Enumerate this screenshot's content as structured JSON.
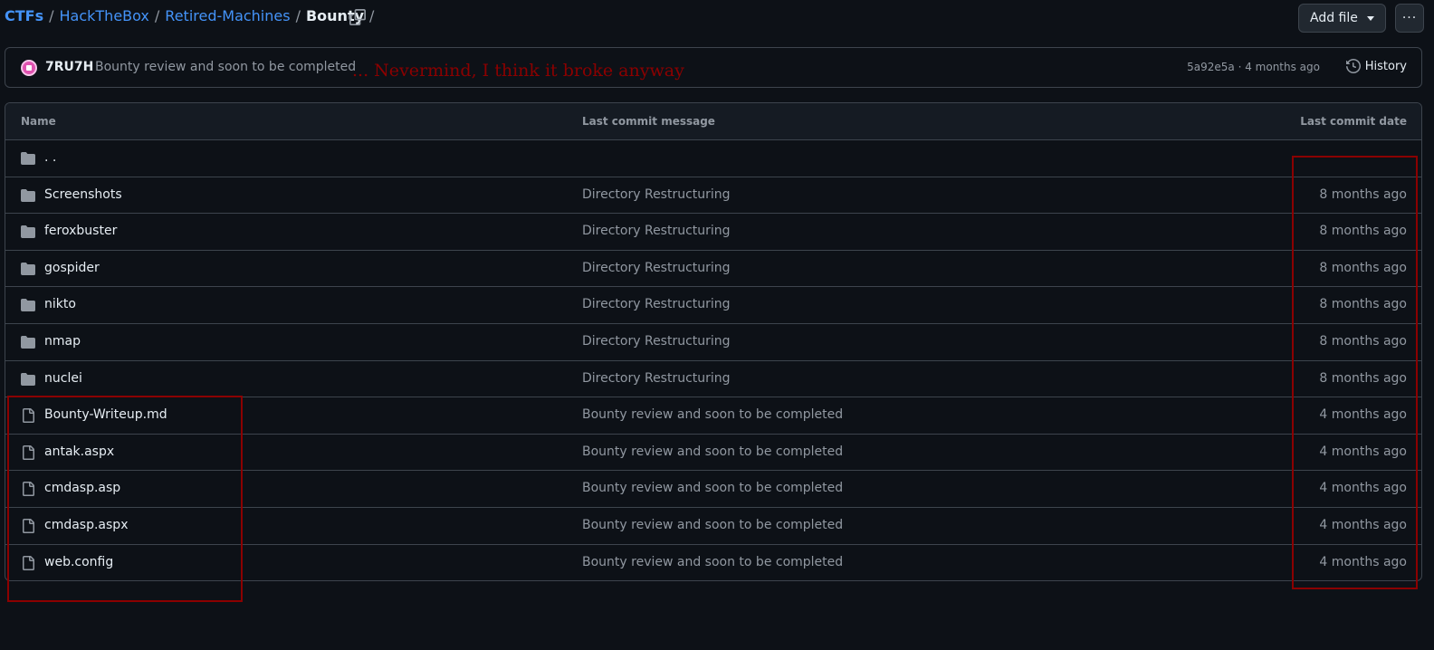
{
  "breadcrumb": {
    "items": [
      "CTFs",
      "HackTheBox",
      "Retired-Machines"
    ],
    "current": "Bounty",
    "separator": "/"
  },
  "toolbar": {
    "add_file_label": "Add file",
    "more_label": "···"
  },
  "latest_commit": {
    "author": "7RU7H",
    "message": "Bounty review and soon to be completed",
    "hash_and_time": "5a92e5a · 4 months ago",
    "history_label": "History"
  },
  "annotation": {
    "text": "... Nevermind, I think it broke anyway",
    "color": "#8b0000"
  },
  "table": {
    "headers": {
      "name": "Name",
      "message": "Last commit message",
      "date": "Last commit date"
    },
    "rows": [
      {
        "type": "folder",
        "name": ". .",
        "message": "",
        "date": ""
      },
      {
        "type": "folder",
        "name": "Screenshots",
        "message": "Directory Restructuring",
        "date": "8 months ago"
      },
      {
        "type": "folder",
        "name": "feroxbuster",
        "message": "Directory Restructuring",
        "date": "8 months ago"
      },
      {
        "type": "folder",
        "name": "gospider",
        "message": "Directory Restructuring",
        "date": "8 months ago"
      },
      {
        "type": "folder",
        "name": "nikto",
        "message": "Directory Restructuring",
        "date": "8 months ago"
      },
      {
        "type": "folder",
        "name": "nmap",
        "message": "Directory Restructuring",
        "date": "8 months ago"
      },
      {
        "type": "folder",
        "name": "nuclei",
        "message": "Directory Restructuring",
        "date": "8 months ago"
      },
      {
        "type": "file",
        "name": "Bounty-Writeup.md",
        "message": "Bounty review and soon to be completed",
        "date": "4 months ago"
      },
      {
        "type": "file",
        "name": "antak.aspx",
        "message": "Bounty review and soon to be completed",
        "date": "4 months ago"
      },
      {
        "type": "file",
        "name": "cmdasp.asp",
        "message": "Bounty review and soon to be completed",
        "date": "4 months ago"
      },
      {
        "type": "file",
        "name": "cmdasp.aspx",
        "message": "Bounty review and soon to be completed",
        "date": "4 months ago"
      },
      {
        "type": "file",
        "name": "web.config",
        "message": "Bounty review and soon to be completed",
        "date": "4 months ago"
      }
    ]
  },
  "colors": {
    "background": "#0d1117",
    "link": "#4493f8",
    "border": "#3d444d",
    "muted": "#9198a1",
    "folder_icon": "#9198a1",
    "annotation_box": "#8b0000"
  }
}
